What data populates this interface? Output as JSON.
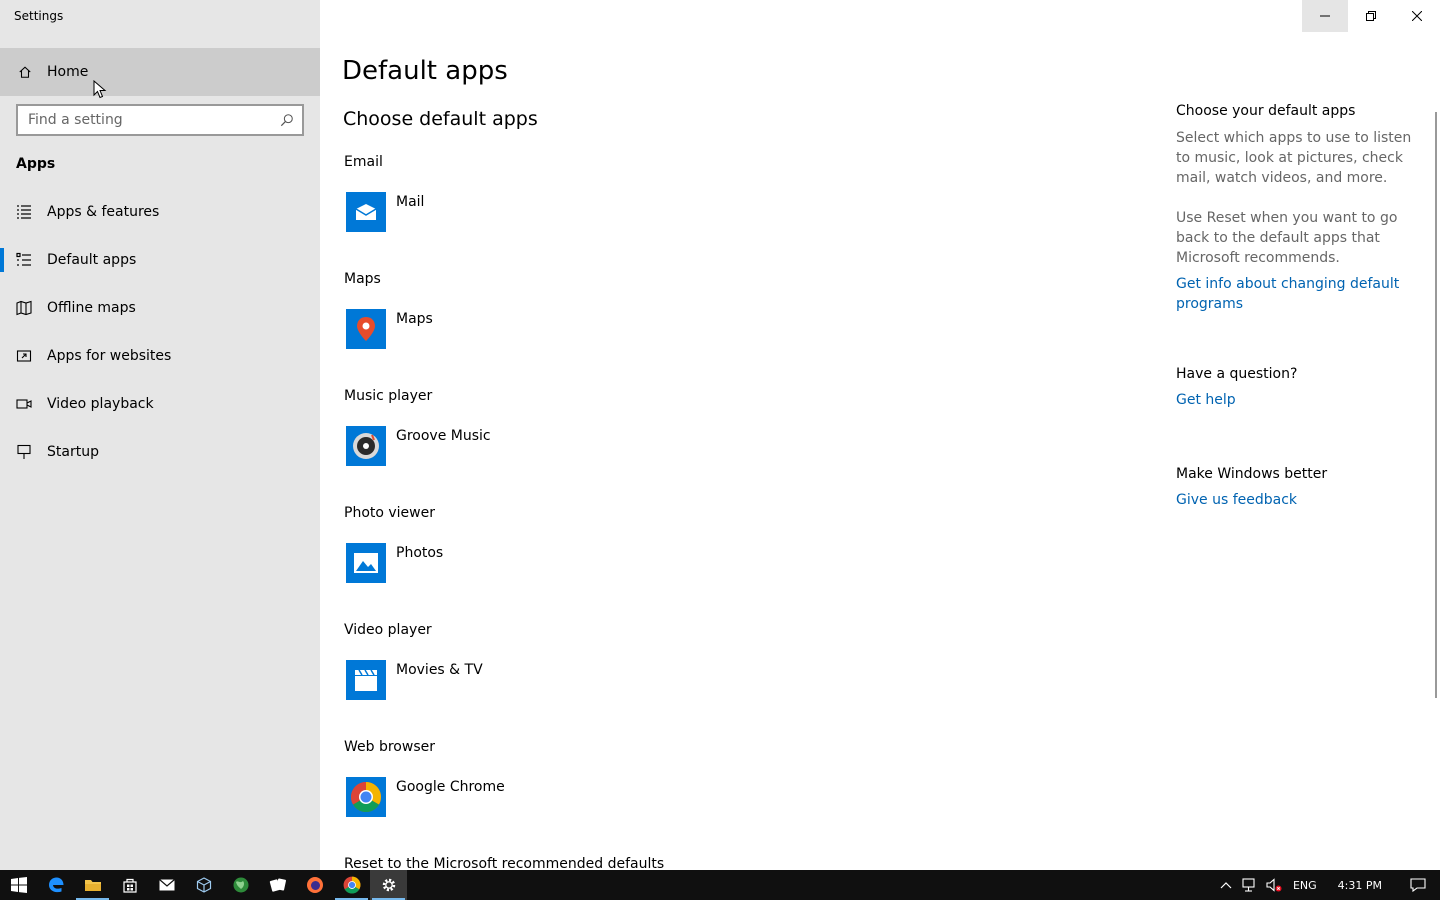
{
  "window": {
    "title": "Settings"
  },
  "sidebar": {
    "home_label": "Home",
    "search_placeholder": "Find a setting",
    "section": "Apps",
    "items": [
      {
        "label": "Apps & features",
        "icon": "list-icon"
      },
      {
        "label": "Default apps",
        "icon": "default-apps-icon",
        "selected": true
      },
      {
        "label": "Offline maps",
        "icon": "map-icon"
      },
      {
        "label": "Apps for websites",
        "icon": "open-link-icon"
      },
      {
        "label": "Video playback",
        "icon": "video-icon"
      },
      {
        "label": "Startup",
        "icon": "startup-icon"
      }
    ]
  },
  "main": {
    "title": "Default apps",
    "subtitle": "Choose default apps",
    "categories": [
      {
        "label": "Email",
        "app": "Mail"
      },
      {
        "label": "Maps",
        "app": "Maps"
      },
      {
        "label": "Music player",
        "app": "Groove Music"
      },
      {
        "label": "Photo viewer",
        "app": "Photos"
      },
      {
        "label": "Video player",
        "app": "Movies & TV"
      },
      {
        "label": "Web browser",
        "app": "Google Chrome"
      }
    ],
    "reset_label": "Reset to the Microsoft recommended defaults"
  },
  "right": {
    "heading1": "Choose your default apps",
    "text1": "Select which apps to use to listen to music, look at pictures, check mail, watch videos, and more.",
    "text2": "Use Reset when you want to go back to the default apps that Microsoft recommends.",
    "link1": "Get info about changing default programs",
    "heading2": "Have a question?",
    "link2": "Get help",
    "heading3": "Make Windows better",
    "link3": "Give us feedback"
  },
  "taskbar": {
    "language": "ENG",
    "time": "4:31 PM"
  },
  "colors": {
    "accent": "#0078d7",
    "link": "#0063b1",
    "sidebar_bg": "#e6e6e6",
    "taskbar_bg": "#101010"
  }
}
